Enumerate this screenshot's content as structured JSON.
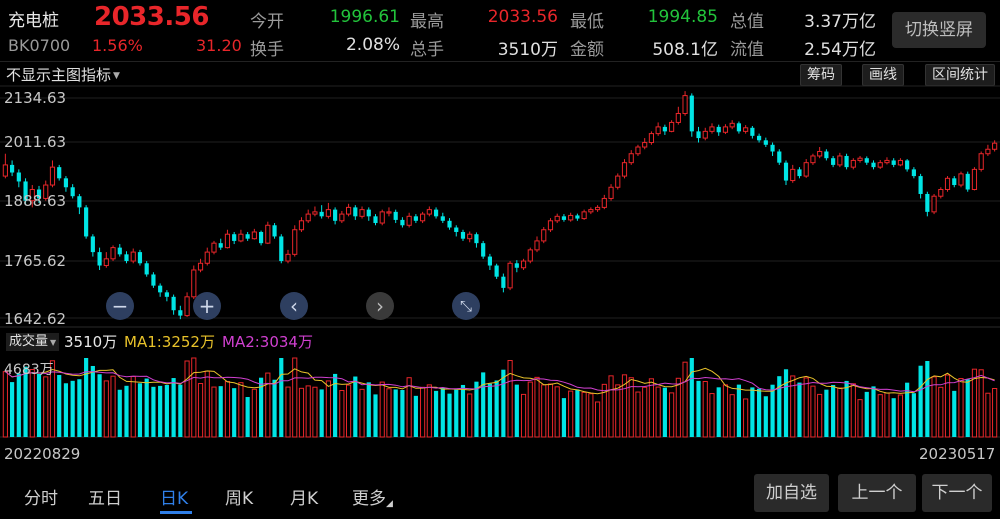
{
  "header": {
    "name": "充电桩",
    "price": "2033.56",
    "code": "BK0700",
    "change_pct": "1.56%",
    "change_abs": "31.20",
    "stats": [
      {
        "label": "今开",
        "value": "1996.61",
        "color": "green"
      },
      {
        "label": "最高",
        "value": "2033.56",
        "color": "red"
      },
      {
        "label": "最低",
        "value": "1994.85",
        "color": "green"
      },
      {
        "label": "总值",
        "value": "3.37万亿",
        "color": "white"
      },
      {
        "label": "换手",
        "value": "2.08%",
        "color": "white"
      },
      {
        "label": "总手",
        "value": "3510万",
        "color": "white"
      },
      {
        "label": "金额",
        "value": "508.1亿",
        "color": "white"
      },
      {
        "label": "流值",
        "value": "2.54万亿",
        "color": "white"
      }
    ],
    "switch_label": "切换竖屏"
  },
  "toolbar": {
    "indicator_select": "不显示主图指标",
    "buttons": [
      "筹码",
      "画线",
      "区间统计"
    ]
  },
  "price_axis": [
    "2134.63",
    "2011.63",
    "1888.63",
    "1765.62",
    "1642.62"
  ],
  "volume": {
    "selector": "成交量",
    "value": "3510万",
    "ma1": "MA1:3252万",
    "ma2": "MA2:3034万",
    "axis_top": "4683万"
  },
  "dates": {
    "start": "20220829",
    "end": "20230517"
  },
  "controls": {
    "zoom_out": "−",
    "zoom_in": "+",
    "prev": "‹",
    "next": "›",
    "collapse": "⤡"
  },
  "tabs": [
    "分时",
    "五日",
    "日K",
    "周K",
    "月K",
    "更多"
  ],
  "active_tab": "日K",
  "bottom_buttons": [
    "加自选",
    "上一个",
    "下一个"
  ],
  "colors": {
    "up": "#e8262a",
    "down": "#00e5e5",
    "ma1": "#e8c22a",
    "ma2": "#d040d0",
    "accent": "#2f7fe8"
  },
  "chart_data": {
    "type": "candlestick",
    "x_range": [
      "20220829",
      "20230517"
    ],
    "ylim": [
      1642.62,
      2134.63
    ],
    "y_ticks": [
      2134.63,
      2011.63,
      1888.63,
      1765.62,
      1642.62
    ],
    "candles": [
      [
        1960,
        1985,
        2010,
        1955
      ],
      [
        1985,
        1968,
        1995,
        1960
      ],
      [
        1968,
        1948,
        1975,
        1935
      ],
      [
        1948,
        1905,
        1955,
        1895
      ],
      [
        1905,
        1930,
        1940,
        1890
      ],
      [
        1930,
        1910,
        1938,
        1900
      ],
      [
        1910,
        1940,
        1950,
        1905
      ],
      [
        1940,
        1980,
        1995,
        1935
      ],
      [
        1980,
        1955,
        1985,
        1950
      ],
      [
        1955,
        1935,
        1960,
        1925
      ],
      [
        1935,
        1915,
        1942,
        1910
      ],
      [
        1915,
        1890,
        1920,
        1875
      ],
      [
        1890,
        1825,
        1895,
        1820
      ],
      [
        1825,
        1790,
        1830,
        1780
      ],
      [
        1790,
        1760,
        1800,
        1750
      ],
      [
        1760,
        1775,
        1790,
        1755
      ],
      [
        1775,
        1800,
        1805,
        1770
      ],
      [
        1800,
        1785,
        1808,
        1780
      ],
      [
        1785,
        1770,
        1792,
        1765
      ],
      [
        1770,
        1790,
        1798,
        1765
      ],
      [
        1790,
        1765,
        1795,
        1760
      ],
      [
        1765,
        1740,
        1770,
        1735
      ],
      [
        1740,
        1715,
        1745,
        1710
      ],
      [
        1715,
        1700,
        1720,
        1690
      ],
      [
        1700,
        1690,
        1705,
        1680
      ],
      [
        1690,
        1660,
        1695,
        1650
      ],
      [
        1660,
        1648,
        1670,
        1640
      ],
      [
        1648,
        1690,
        1700,
        1645
      ],
      [
        1690,
        1750,
        1760,
        1685
      ],
      [
        1750,
        1765,
        1775,
        1745
      ],
      [
        1765,
        1790,
        1800,
        1760
      ],
      [
        1790,
        1810,
        1815,
        1785
      ],
      [
        1810,
        1800,
        1820,
        1795
      ],
      [
        1800,
        1830,
        1840,
        1798
      ],
      [
        1830,
        1815,
        1835,
        1808
      ],
      [
        1815,
        1830,
        1840,
        1812
      ],
      [
        1830,
        1820,
        1835,
        1815
      ],
      [
        1820,
        1835,
        1842,
        1818
      ],
      [
        1835,
        1810,
        1838,
        1805
      ],
      [
        1810,
        1850,
        1858,
        1808
      ],
      [
        1850,
        1825,
        1855,
        1820
      ],
      [
        1825,
        1770,
        1830,
        1765
      ],
      [
        1770,
        1785,
        1795,
        1765
      ],
      [
        1785,
        1840,
        1850,
        1780
      ],
      [
        1840,
        1860,
        1868,
        1835
      ],
      [
        1860,
        1875,
        1885,
        1855
      ],
      [
        1875,
        1880,
        1892,
        1870
      ],
      [
        1880,
        1870,
        1895,
        1865
      ],
      [
        1870,
        1885,
        1900,
        1865
      ],
      [
        1885,
        1860,
        1890,
        1852
      ],
      [
        1860,
        1875,
        1882,
        1855
      ],
      [
        1875,
        1890,
        1898,
        1870
      ],
      [
        1890,
        1870,
        1895,
        1862
      ],
      [
        1870,
        1885,
        1892,
        1865
      ],
      [
        1885,
        1870,
        1890,
        1860
      ],
      [
        1870,
        1855,
        1875,
        1850
      ],
      [
        1855,
        1880,
        1885,
        1850
      ],
      [
        1880,
        1880,
        1890,
        1870
      ],
      [
        1880,
        1862,
        1885,
        1855
      ],
      [
        1862,
        1850,
        1868,
        1845
      ],
      [
        1850,
        1870,
        1878,
        1845
      ],
      [
        1870,
        1860,
        1875,
        1855
      ],
      [
        1860,
        1875,
        1880,
        1855
      ],
      [
        1875,
        1885,
        1892,
        1870
      ],
      [
        1885,
        1870,
        1890,
        1865
      ],
      [
        1870,
        1860,
        1878,
        1855
      ],
      [
        1860,
        1845,
        1866,
        1840
      ],
      [
        1845,
        1835,
        1850,
        1825
      ],
      [
        1835,
        1820,
        1840,
        1815
      ],
      [
        1820,
        1830,
        1836,
        1812
      ],
      [
        1830,
        1810,
        1834,
        1800
      ],
      [
        1810,
        1780,
        1815,
        1775
      ],
      [
        1780,
        1760,
        1786,
        1750
      ],
      [
        1760,
        1735,
        1764,
        1730
      ],
      [
        1735,
        1710,
        1742,
        1700
      ],
      [
        1710,
        1765,
        1770,
        1705
      ],
      [
        1765,
        1755,
        1772,
        1745
      ],
      [
        1755,
        1770,
        1775,
        1750
      ],
      [
        1770,
        1795,
        1800,
        1765
      ],
      [
        1795,
        1815,
        1825,
        1790
      ],
      [
        1815,
        1840,
        1846,
        1810
      ],
      [
        1840,
        1860,
        1866,
        1835
      ],
      [
        1860,
        1870,
        1876,
        1855
      ],
      [
        1870,
        1862,
        1875,
        1858
      ],
      [
        1862,
        1872,
        1878,
        1858
      ],
      [
        1872,
        1865,
        1876,
        1860
      ],
      [
        1865,
        1880,
        1885,
        1862
      ],
      [
        1880,
        1885,
        1890,
        1875
      ],
      [
        1885,
        1890,
        1895,
        1880
      ],
      [
        1890,
        1910,
        1918,
        1886
      ],
      [
        1910,
        1935,
        1942,
        1905
      ],
      [
        1935,
        1960,
        1966,
        1930
      ],
      [
        1960,
        1990,
        1998,
        1955
      ],
      [
        1990,
        2010,
        2018,
        1985
      ],
      [
        2010,
        2025,
        2030,
        2005
      ],
      [
        2025,
        2035,
        2045,
        2020
      ],
      [
        2035,
        2055,
        2060,
        2030
      ],
      [
        2055,
        2070,
        2080,
        2050
      ],
      [
        2070,
        2060,
        2075,
        2052
      ],
      [
        2060,
        2080,
        2085,
        2058
      ],
      [
        2080,
        2100,
        2115,
        2075
      ],
      [
        2100,
        2140,
        2150,
        2095
      ],
      [
        2140,
        2060,
        2145,
        2048
      ],
      [
        2060,
        2045,
        2070,
        2035
      ],
      [
        2045,
        2060,
        2068,
        2040
      ],
      [
        2060,
        2070,
        2078,
        2055
      ],
      [
        2070,
        2058,
        2075,
        2050
      ],
      [
        2058,
        2070,
        2076,
        2054
      ],
      [
        2070,
        2078,
        2085,
        2065
      ],
      [
        2078,
        2060,
        2082,
        2055
      ],
      [
        2060,
        2068,
        2074,
        2055
      ],
      [
        2068,
        2050,
        2072,
        2044
      ],
      [
        2050,
        2040,
        2055,
        2035
      ],
      [
        2040,
        2030,
        2046,
        2025
      ],
      [
        2030,
        2015,
        2035,
        2005
      ],
      [
        2015,
        1990,
        2020,
        1985
      ],
      [
        1990,
        1950,
        1995,
        1940
      ],
      [
        1950,
        1975,
        1985,
        1945
      ],
      [
        1975,
        1960,
        1980,
        1955
      ],
      [
        1960,
        1990,
        1998,
        1956
      ],
      [
        1990,
        2005,
        2010,
        1985
      ],
      [
        2005,
        2015,
        2025,
        2000
      ],
      [
        2015,
        2000,
        2020,
        1995
      ],
      [
        2000,
        1985,
        2005,
        1980
      ],
      [
        1985,
        2005,
        2012,
        1980
      ],
      [
        2005,
        1980,
        2010,
        1975
      ],
      [
        1980,
        1995,
        2000,
        1975
      ],
      [
        1995,
        2000,
        2005,
        1990
      ],
      [
        2000,
        1990,
        2004,
        1985
      ],
      [
        1990,
        1980,
        1995,
        1975
      ],
      [
        1980,
        1990,
        1996,
        1976
      ],
      [
        1990,
        1995,
        2002,
        1986
      ],
      [
        1995,
        1985,
        2000,
        1980
      ],
      [
        1985,
        1995,
        2000,
        1982
      ],
      [
        1995,
        1975,
        1998,
        1970
      ],
      [
        1975,
        1960,
        1980,
        1955
      ],
      [
        1960,
        1920,
        1965,
        1910
      ],
      [
        1920,
        1880,
        1925,
        1870
      ],
      [
        1880,
        1915,
        1920,
        1875
      ],
      [
        1915,
        1930,
        1935,
        1910
      ],
      [
        1930,
        1955,
        1960,
        1925
      ],
      [
        1955,
        1940,
        1960,
        1935
      ],
      [
        1940,
        1965,
        1970,
        1935
      ],
      [
        1965,
        1930,
        1970,
        1925
      ],
      [
        1930,
        1975,
        1980,
        1928
      ],
      [
        1975,
        2010,
        2015,
        1970
      ],
      [
        2010,
        2020,
        2030,
        2005
      ],
      [
        2020,
        2033.56,
        2040,
        2015
      ]
    ],
    "volume_unit": "万",
    "volume_range": [
      0,
      4683
    ]
  }
}
